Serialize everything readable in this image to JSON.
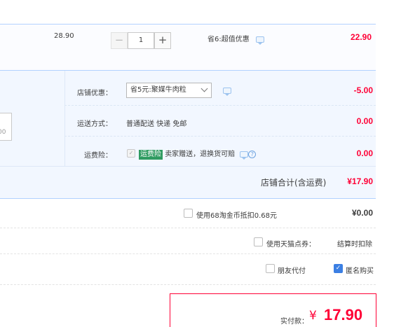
{
  "item": {
    "unit_price": "28.90",
    "quantity": "1",
    "minus": "−",
    "plus": "+",
    "discount_note": "省6:超值优惠",
    "subtotal": "22.90"
  },
  "order": {
    "message_placeholder_tail": "00",
    "shop_promo": {
      "label": "店铺优惠：",
      "selected": "省5元:聚媒牛肉粒",
      "amount": "-5.00"
    },
    "shipping": {
      "label": "运送方式：",
      "value": "普通配送 快递 免邮",
      "amount": "0.00"
    },
    "insurance": {
      "label": "运费险：",
      "tag": "运费险",
      "desc": "卖家赠送，退换货可赔",
      "amount": "0.00",
      "help": "?"
    },
    "shop_total_label": "店铺合计(含运费)",
    "shop_total_value": "¥17.90"
  },
  "options": {
    "coins_label": "使用68淘金币抵扣0.68元",
    "coins_value": "¥0.00",
    "tmall_points_label": "使用天猫点券：",
    "tmall_points_value": "结算时扣除",
    "friend_pay_label": "朋友代付",
    "anonymous_label": "匿名购买"
  },
  "payment": {
    "label": "实付款：",
    "currency": "¥",
    "amount": "17.90"
  },
  "colors": {
    "accent_red": "#ff0036",
    "border_blue": "#b2d1ff",
    "panel_bg": "#f2f7ff",
    "checkbox_blue": "#3b7fe3",
    "tag_green": "#2f9b61"
  }
}
